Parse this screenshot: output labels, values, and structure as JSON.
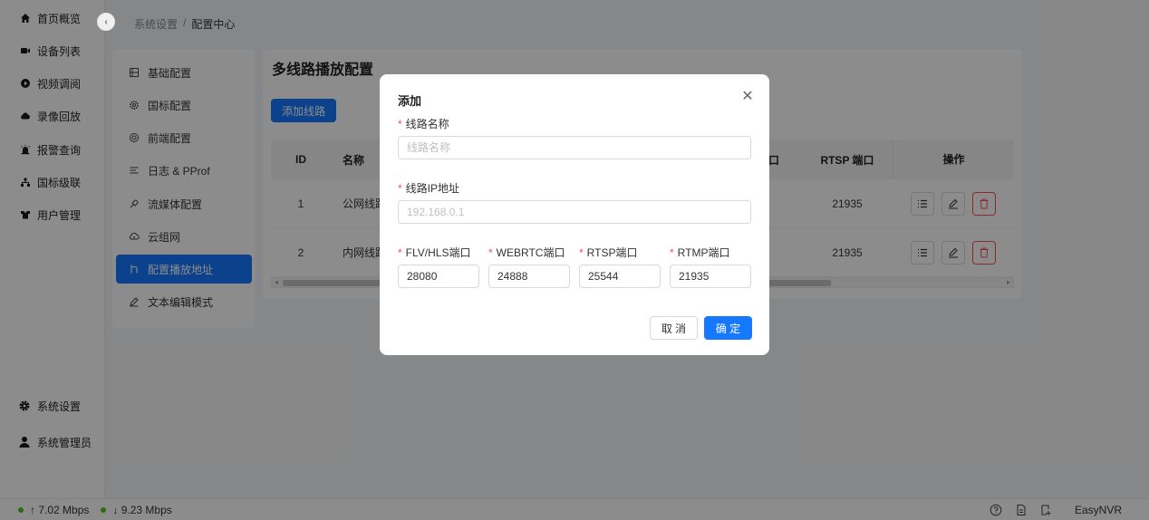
{
  "sidebar": {
    "items": [
      {
        "label": "首页概览",
        "icon": "home-icon"
      },
      {
        "label": "设备列表",
        "icon": "camera-icon"
      },
      {
        "label": "视频调阅",
        "icon": "play-icon"
      },
      {
        "label": "录像回放",
        "icon": "cloud-icon"
      },
      {
        "label": "报警查询",
        "icon": "alarm-icon"
      },
      {
        "label": "国标级联",
        "icon": "cascade-icon"
      },
      {
        "label": "用户管理",
        "icon": "users-icon"
      }
    ],
    "bottom": [
      {
        "label": "系统设置",
        "icon": "gear-icon"
      },
      {
        "label": "系统管理员",
        "icon": "user-icon"
      }
    ]
  },
  "breadcrumb": {
    "parent": "系统设置",
    "separator": "/",
    "current": "配置中心"
  },
  "submenu": {
    "items": [
      {
        "label": "基础配置",
        "icon": "layout-icon"
      },
      {
        "label": "国标配置",
        "icon": "settings-icon"
      },
      {
        "label": "前端配置",
        "icon": "frontend-icon"
      },
      {
        "label": "日志 & PProf",
        "icon": "log-icon"
      },
      {
        "label": "流媒体配置",
        "icon": "stream-icon"
      },
      {
        "label": "云组网",
        "icon": "cloud-net-icon"
      },
      {
        "label": "配置播放地址",
        "icon": "route-icon",
        "active": true
      },
      {
        "label": "文本编辑模式",
        "icon": "edit-icon"
      }
    ]
  },
  "main": {
    "title": "多线路播放配置",
    "add_button": "添加线路",
    "table": {
      "headers": {
        "id": "ID",
        "name": "名称",
        "port_tail": "口",
        "rtsp": "RTSP 端口",
        "actions": "操作"
      },
      "rows": [
        {
          "id": "1",
          "name": "公网线路",
          "rtsp": "21935"
        },
        {
          "id": "2",
          "name": "内网线路",
          "rtsp": "21935"
        }
      ]
    }
  },
  "statusbar": {
    "upload": "↑ 7.02 Mbps",
    "download": "↓ 9.23 Mbps",
    "brand": "EasyNVR"
  },
  "modal": {
    "title": "添加",
    "fields": {
      "name": {
        "label": "线路名称",
        "placeholder": "线路名称",
        "value": ""
      },
      "ip": {
        "label": "线路IP地址",
        "placeholder": "192.168.0.1",
        "value": ""
      },
      "flv": {
        "label": "FLV/HLS端口",
        "value": "28080"
      },
      "webrtc": {
        "label": "WEBRTC端口",
        "value": "24888"
      },
      "rtsp": {
        "label": "RTSP端口",
        "value": "25544"
      },
      "rtmp": {
        "label": "RTMP端口",
        "value": "21935"
      }
    },
    "cancel": "取 消",
    "ok": "确 定"
  },
  "colors": {
    "primary": "#1677ff",
    "danger": "#ff4d4f",
    "online": "#52c41a"
  }
}
